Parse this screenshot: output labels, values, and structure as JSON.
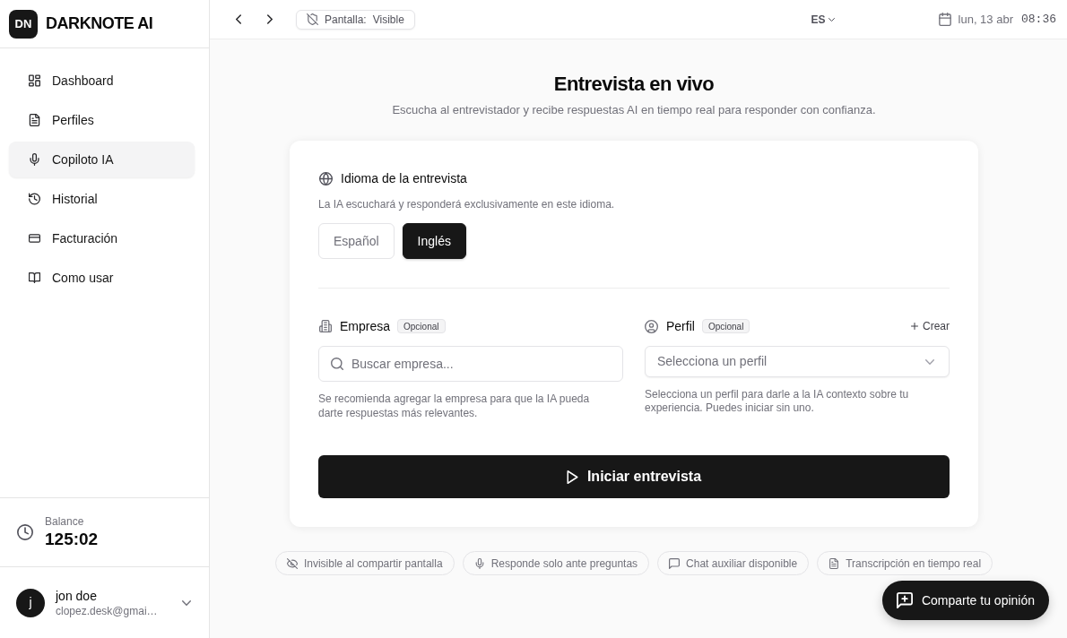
{
  "brand": {
    "logo": "DN",
    "name": "DARKNOTE AI"
  },
  "sidebar": {
    "items": [
      {
        "label": "Dashboard",
        "selected": false
      },
      {
        "label": "Perfiles",
        "selected": false
      },
      {
        "label": "Copiloto IA",
        "selected": true
      },
      {
        "label": "Historial",
        "selected": false
      },
      {
        "label": "Facturación",
        "selected": false
      },
      {
        "label": "Como usar",
        "selected": false
      }
    ]
  },
  "balance": {
    "label": "Balance",
    "value": "125:02"
  },
  "user": {
    "avatar": "j",
    "name": "jon doe",
    "email": "clopez.desk@gmai…"
  },
  "topbar": {
    "screen": {
      "label": "Pantalla:",
      "value": "Visible"
    },
    "language": "ES",
    "date": "lun, 13 abr",
    "time": "08:36"
  },
  "header": {
    "title": "Entrevista en vivo",
    "subtitle": "Escucha al entrevistador y recibe respuestas AI en tiempo real para responder con confianza."
  },
  "interview_language": {
    "title": "Idioma de la entrevista",
    "hint": "La IA escuchará y responderá exclusivamente en este idioma.",
    "options": [
      {
        "label": "Español",
        "selected": false
      },
      {
        "label": "Inglés",
        "selected": true
      }
    ]
  },
  "company": {
    "label": "Empresa",
    "badge": "Opcional",
    "placeholder": "Buscar empresa...",
    "help": "Se recomienda agregar la empresa para que la IA pueda darte respuestas más relevantes."
  },
  "profile": {
    "label": "Perfil",
    "badge": "Opcional",
    "create": "Crear",
    "placeholder": "Selecciona un perfil",
    "help": "Selecciona un perfil para darle a la IA contexto sobre tu experiencia. Puedes iniciar sin uno."
  },
  "start_button": "Iniciar entrevista",
  "features": [
    "Invisible al compartir pantalla",
    "Responde solo ante preguntas",
    "Chat auxiliar disponible",
    "Transcripción en tiempo real"
  ],
  "feedback_button": "Comparte tu opinión"
}
